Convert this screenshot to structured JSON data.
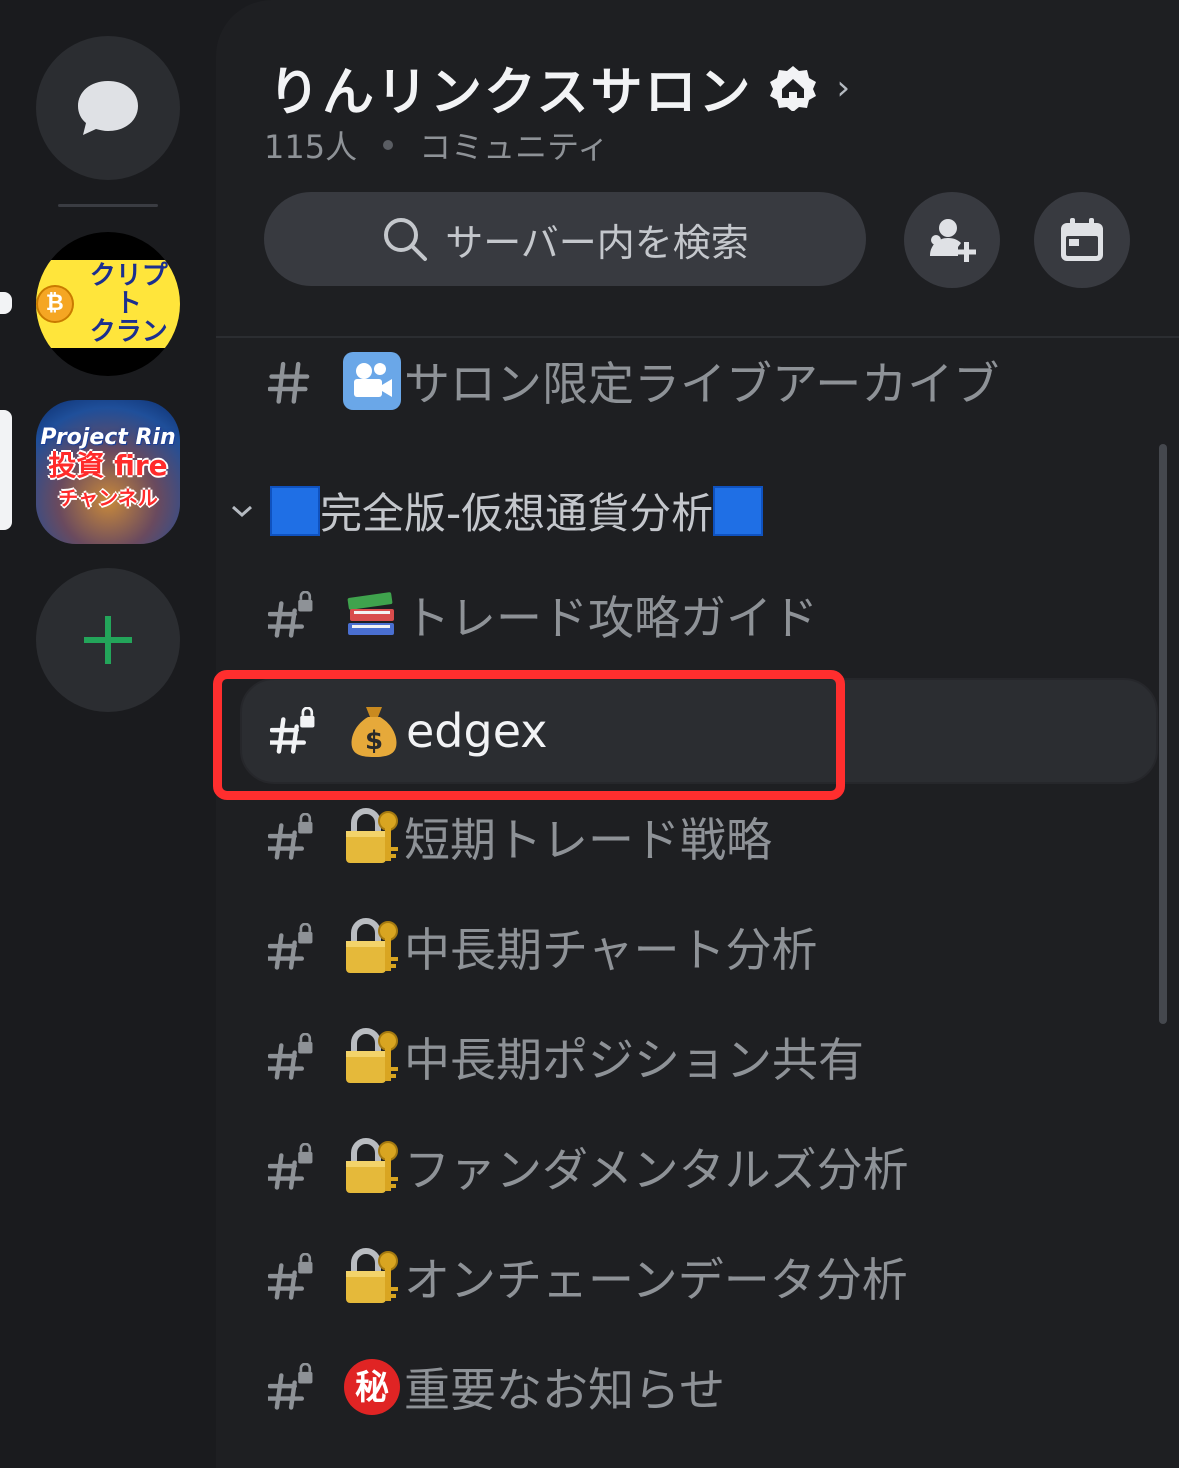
{
  "server_rail": {
    "dm_icon": "chat-bubble-icon",
    "servers": [
      {
        "name_lines": [
          "クリプト",
          "クラン"
        ],
        "coin_glyph": "₿"
      },
      {
        "line1": "Project Rin",
        "line2": "投資 fire",
        "line3": "チャンネル"
      }
    ],
    "add_icon": "plus-icon",
    "colors": {
      "add": "#23a55a"
    }
  },
  "server": {
    "name": "りんリンクスサロン",
    "member_count": "115人",
    "type": "コミュニティ",
    "chevron": "›"
  },
  "search": {
    "placeholder": "サーバー内を検索"
  },
  "top_channel": {
    "name": "サロン限定ライブアーカイブ"
  },
  "category": {
    "name": "完全版-仮想通貨分析"
  },
  "channels": [
    {
      "name": "トレード攻略ガイド",
      "emoji": "books"
    },
    {
      "name": "edgex",
      "emoji": "money-bag",
      "selected": true
    },
    {
      "name": "短期トレード戦略",
      "emoji": "lock-with-key"
    },
    {
      "name": "中長期チャート分析",
      "emoji": "lock-with-key"
    },
    {
      "name": "中長期ポジション共有",
      "emoji": "lock-with-key"
    },
    {
      "name": "ファンダメンタルズ分析",
      "emoji": "lock-with-key"
    },
    {
      "name": "オンチェーンデータ分析",
      "emoji": "lock-with-key"
    },
    {
      "name": "重要なお知らせ",
      "emoji": "secret-mark"
    }
  ],
  "colors": {
    "background": "#1e1f22",
    "highlight": "#ff2e2e",
    "category_square": "#1f6fe5"
  }
}
